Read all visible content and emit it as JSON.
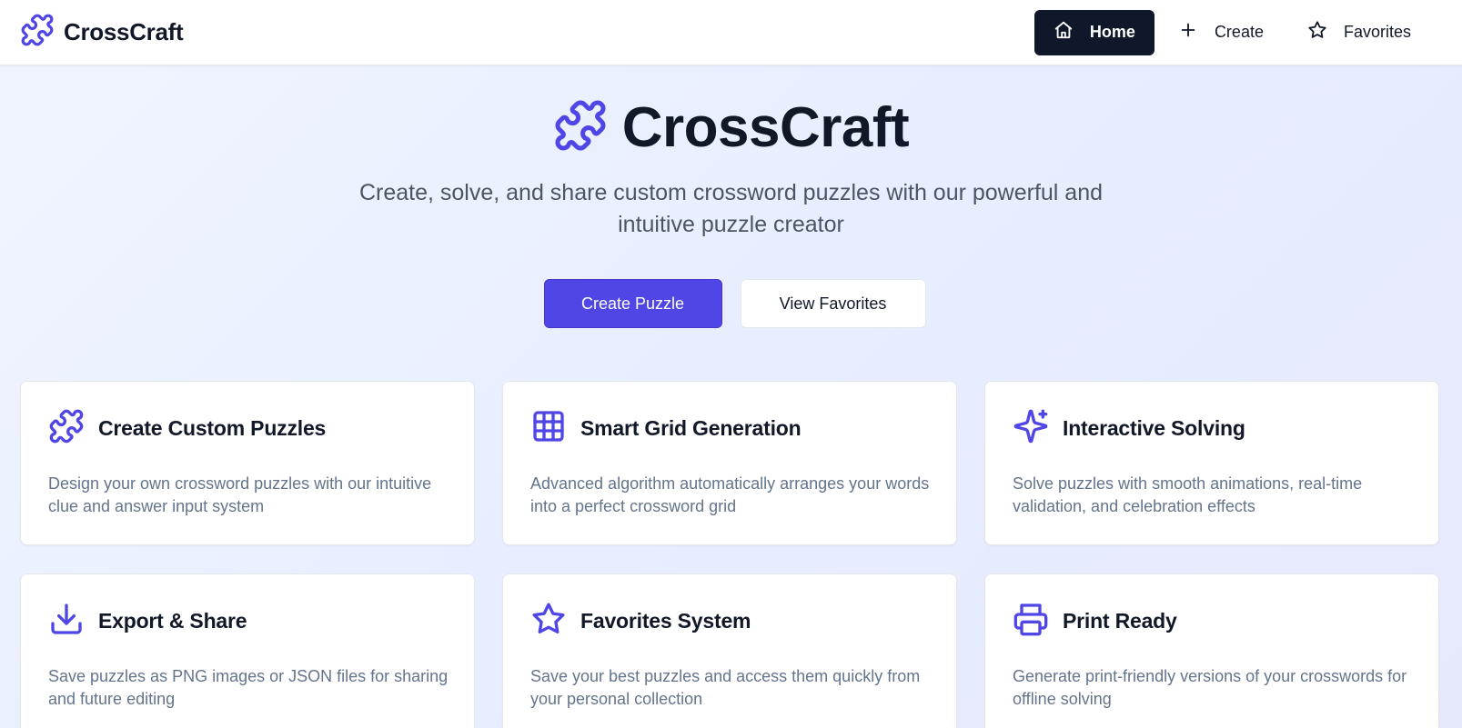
{
  "header": {
    "brand_name": "CrossCraft",
    "brand_icon": "puzzle-icon",
    "nav": [
      {
        "label": "Home",
        "icon": "home-icon",
        "active": true
      },
      {
        "label": "Create",
        "icon": "plus-icon",
        "active": false
      },
      {
        "label": "Favorites",
        "icon": "star-icon",
        "active": false
      }
    ]
  },
  "hero": {
    "title": "CrossCraft",
    "subtitle": "Create, solve, and share custom crossword puzzles with our powerful and intuitive puzzle creator",
    "primary_button": "Create Puzzle",
    "secondary_button": "View Favorites"
  },
  "features": [
    {
      "icon": "puzzle-icon",
      "title": "Create Custom Puzzles",
      "description": "Design your own crossword puzzles with our intuitive clue and answer input system"
    },
    {
      "icon": "grid-icon",
      "title": "Smart Grid Generation",
      "description": "Advanced algorithm automatically arranges your words into a perfect crossword grid"
    },
    {
      "icon": "sparkles-icon",
      "title": "Interactive Solving",
      "description": "Solve puzzles with smooth animations, real-time validation, and celebration effects"
    },
    {
      "icon": "download-icon",
      "title": "Export & Share",
      "description": "Save puzzles as PNG images or JSON files for sharing and future editing"
    },
    {
      "icon": "star-icon",
      "title": "Favorites System",
      "description": "Save your best puzzles and access them quickly from your personal collection"
    },
    {
      "icon": "printer-icon",
      "title": "Print Ready",
      "description": "Generate print-friendly versions of your crosswords for offline solving"
    }
  ],
  "colors": {
    "accent": "#4f46e5",
    "nav_active_bg": "#0f172a",
    "text_primary": "#111827",
    "text_muted": "#64748b"
  }
}
